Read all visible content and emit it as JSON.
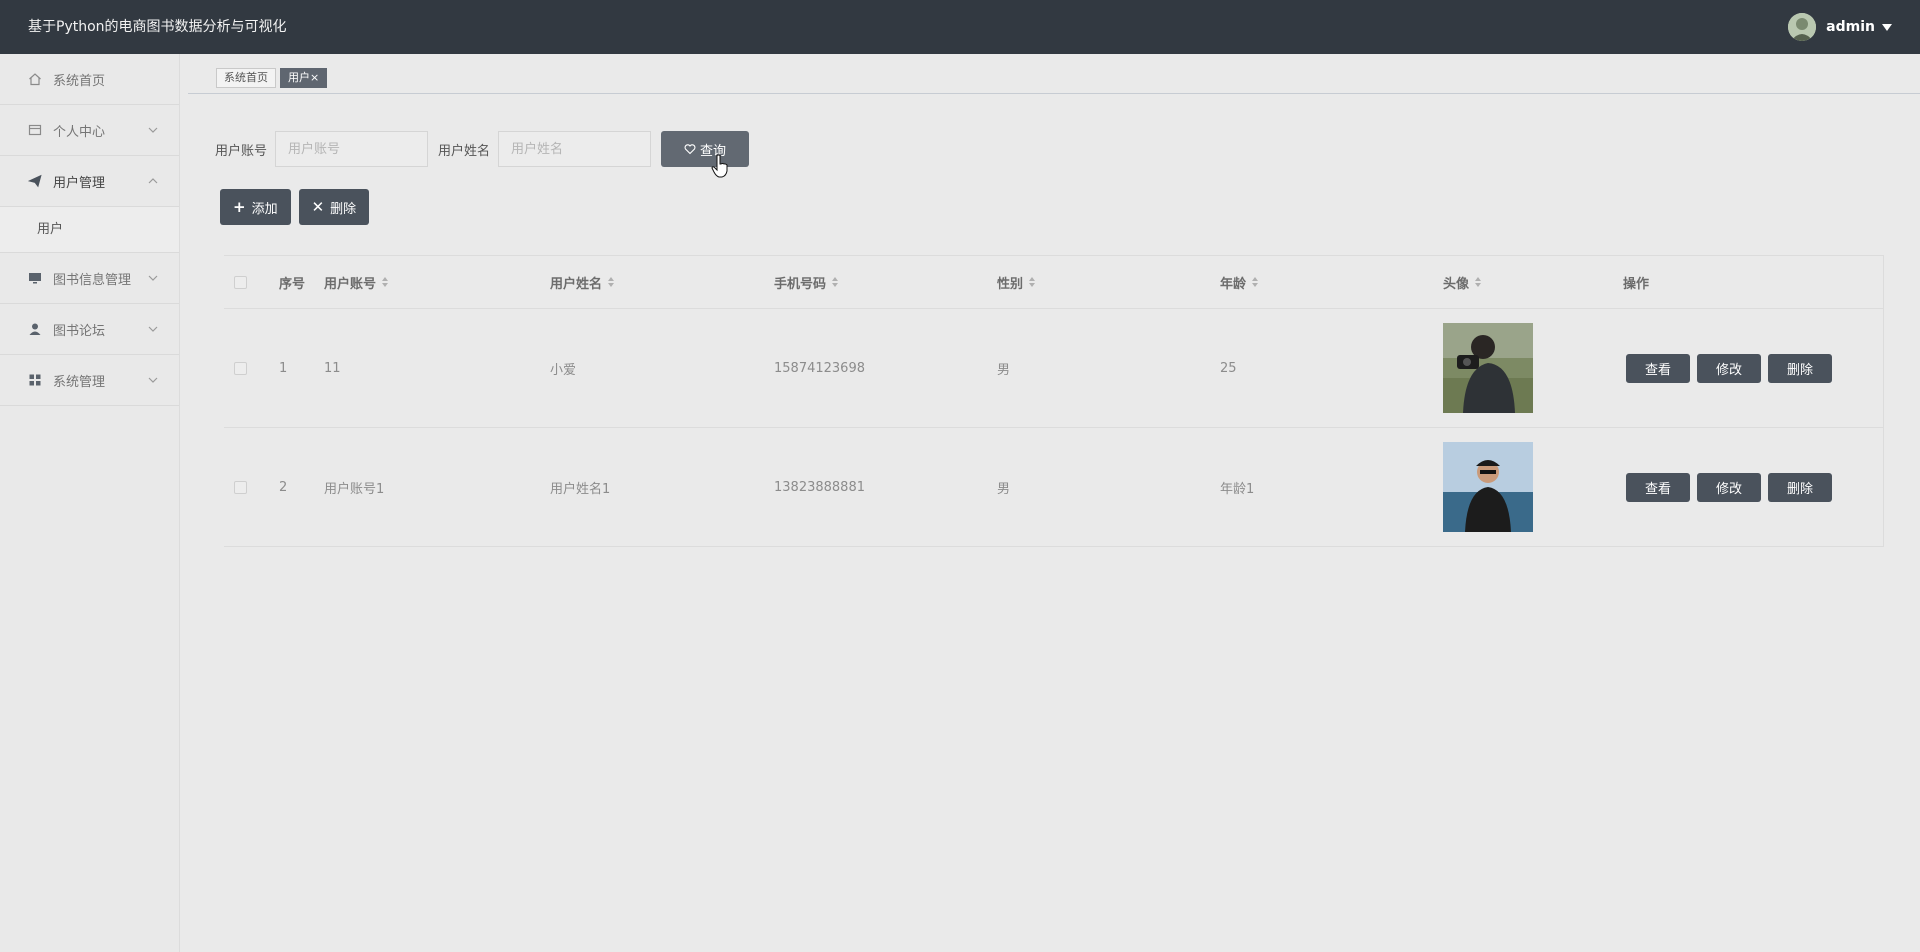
{
  "app": {
    "title": "基于Python的电商图书数据分析与可视化"
  },
  "user": {
    "name": "admin"
  },
  "sidebar": {
    "items": [
      {
        "label": "系统首页",
        "icon": "home-icon"
      },
      {
        "label": "个人中心",
        "icon": "id-card-icon"
      },
      {
        "label": "用户管理",
        "icon": "paper-plane-icon"
      },
      {
        "label": "图书信息管理",
        "icon": "monitor-icon"
      },
      {
        "label": "图书论坛",
        "icon": "person-icon"
      },
      {
        "label": "系统管理",
        "icon": "grid-icon"
      }
    ],
    "sub_items": [
      {
        "label": "用户"
      }
    ]
  },
  "tabs": {
    "home": "系统首页",
    "user": "用户",
    "close_glyph": "×"
  },
  "search": {
    "account_label": "用户账号",
    "account_placeholder": "用户账号",
    "name_label": "用户姓名",
    "name_placeholder": "用户姓名",
    "button": "查询"
  },
  "actions": {
    "add": "添加",
    "delete": "删除"
  },
  "table": {
    "headers": {
      "index": "序号",
      "account": "用户账号",
      "name": "用户姓名",
      "phone": "手机号码",
      "gender": "性别",
      "age": "年龄",
      "avatar": "头像",
      "ops": "操作"
    },
    "rows": [
      {
        "index": "1",
        "account": "11",
        "name": "小爱",
        "phone": "15874123698",
        "gender": "男",
        "age": "25"
      },
      {
        "index": "2",
        "account": "用户账号1",
        "name": "用户姓名1",
        "phone": "13823888881",
        "gender": "男",
        "age": "年龄1"
      }
    ],
    "row_actions": {
      "view": "查看",
      "edit": "修改",
      "delete": "删除"
    }
  },
  "colors": {
    "topbar": "#323941",
    "button_dark": "#4a525c",
    "button_search": "#626972",
    "background": "#eaeaea"
  }
}
